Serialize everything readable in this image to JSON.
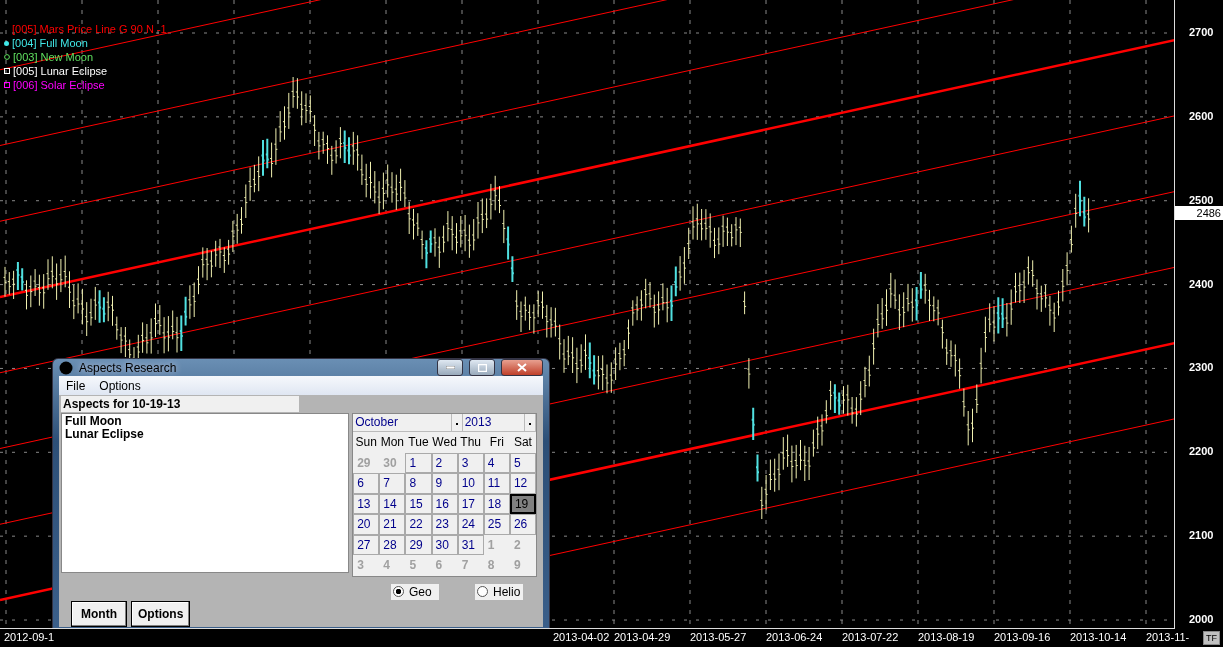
{
  "legend": [
    {
      "label": "[005] Mars Price Line G 90 N -1",
      "color": "#ff0000",
      "kind": "line"
    },
    {
      "label": "[004] Full Moon",
      "color": "#40e8e8",
      "kind": "dot"
    },
    {
      "label": "[003] New Moon",
      "color": "#60e060",
      "kind": "ring"
    },
    {
      "label": "[005] Lunar Eclipse",
      "color": "#ffffff",
      "kind": "square"
    },
    {
      "label": "[006] Solar Eclipse",
      "color": "#ff00ff",
      "kind": "square"
    }
  ],
  "price_axis": [
    "2700",
    "2600",
    "2500",
    "2400",
    "2300",
    "2200",
    "2100",
    "2000"
  ],
  "last_price": "2486",
  "date_axis": [
    "2012-09-1",
    "2013-04-02",
    "2013-04-29",
    "2013-05-27",
    "2013-06-24",
    "2013-07-22",
    "2013-08-19",
    "2013-09-16",
    "2013-10-14",
    "2013-11-"
  ],
  "corner_button": "TF",
  "dialog": {
    "title": "Aspects Research",
    "menu": [
      "File",
      "Options"
    ],
    "header": "Aspects for 10-19-13",
    "aspects": [
      "Full Moon",
      "Lunar Eclipse"
    ],
    "calendar": {
      "month": "October",
      "year": "2013",
      "weekdays": [
        "Sun",
        "Mon",
        "Tue",
        "Wed",
        "Thu",
        "Fri",
        "Sat"
      ],
      "days": [
        {
          "label": "29",
          "in_month": false,
          "selected": false
        },
        {
          "label": "30",
          "in_month": false,
          "selected": false
        },
        {
          "label": "1",
          "in_month": true,
          "selected": false
        },
        {
          "label": "2",
          "in_month": true,
          "selected": false
        },
        {
          "label": "3",
          "in_month": true,
          "selected": false
        },
        {
          "label": "4",
          "in_month": true,
          "selected": false
        },
        {
          "label": "5",
          "in_month": true,
          "selected": false
        },
        {
          "label": "6",
          "in_month": true,
          "selected": false
        },
        {
          "label": "7",
          "in_month": true,
          "selected": false
        },
        {
          "label": "8",
          "in_month": true,
          "selected": false
        },
        {
          "label": "9",
          "in_month": true,
          "selected": false
        },
        {
          "label": "10",
          "in_month": true,
          "selected": false
        },
        {
          "label": "11",
          "in_month": true,
          "selected": false
        },
        {
          "label": "12",
          "in_month": true,
          "selected": false
        },
        {
          "label": "13",
          "in_month": true,
          "selected": false
        },
        {
          "label": "14",
          "in_month": true,
          "selected": false
        },
        {
          "label": "15",
          "in_month": true,
          "selected": false
        },
        {
          "label": "16",
          "in_month": true,
          "selected": false
        },
        {
          "label": "17",
          "in_month": true,
          "selected": false
        },
        {
          "label": "18",
          "in_month": true,
          "selected": false
        },
        {
          "label": "19",
          "in_month": true,
          "selected": true
        },
        {
          "label": "20",
          "in_month": true,
          "selected": false
        },
        {
          "label": "21",
          "in_month": true,
          "selected": false
        },
        {
          "label": "22",
          "in_month": true,
          "selected": false
        },
        {
          "label": "23",
          "in_month": true,
          "selected": false
        },
        {
          "label": "24",
          "in_month": true,
          "selected": false
        },
        {
          "label": "25",
          "in_month": true,
          "selected": false
        },
        {
          "label": "26",
          "in_month": true,
          "selected": false
        },
        {
          "label": "27",
          "in_month": true,
          "selected": false
        },
        {
          "label": "28",
          "in_month": true,
          "selected": false
        },
        {
          "label": "29",
          "in_month": true,
          "selected": false
        },
        {
          "label": "30",
          "in_month": true,
          "selected": false
        },
        {
          "label": "31",
          "in_month": true,
          "selected": false
        },
        {
          "label": "1",
          "in_month": false,
          "selected": false
        },
        {
          "label": "2",
          "in_month": false,
          "selected": false
        },
        {
          "label": "3",
          "in_month": false,
          "selected": false
        },
        {
          "label": "4",
          "in_month": false,
          "selected": false
        },
        {
          "label": "5",
          "in_month": false,
          "selected": false
        },
        {
          "label": "6",
          "in_month": false,
          "selected": false
        },
        {
          "label": "7",
          "in_month": false,
          "selected": false
        },
        {
          "label": "8",
          "in_month": false,
          "selected": false
        },
        {
          "label": "9",
          "in_month": false,
          "selected": false
        }
      ]
    },
    "radios": [
      {
        "label": "Geo",
        "selected": true
      },
      {
        "label": "Helio",
        "selected": false
      }
    ],
    "buttons": [
      "Month",
      "Options"
    ]
  }
}
